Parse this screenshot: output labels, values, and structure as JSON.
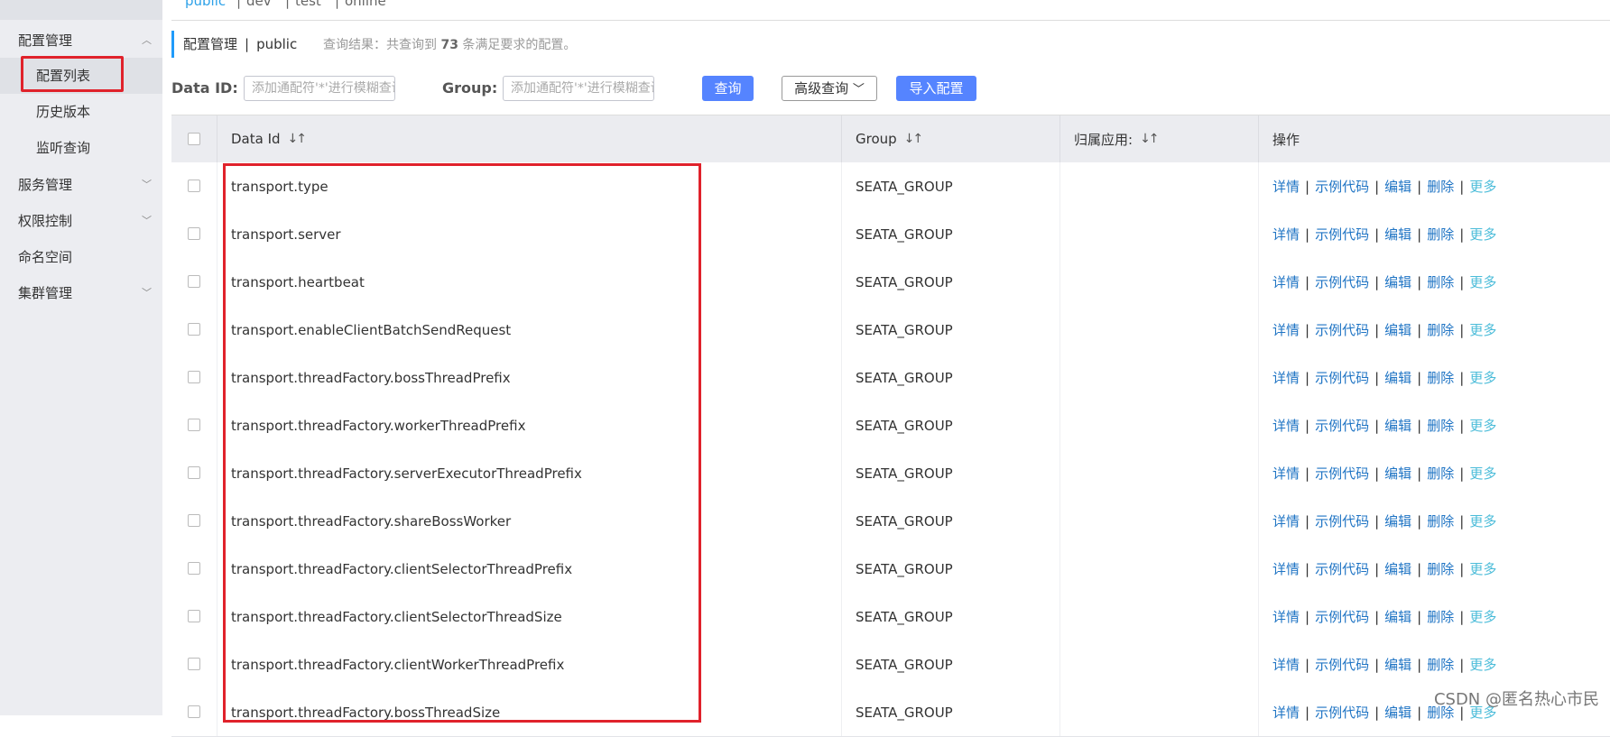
{
  "namespaces": [
    "public",
    "dev",
    "test",
    "online"
  ],
  "sidebar": {
    "items": [
      {
        "label": "配置管理",
        "expanded": true
      },
      {
        "label": "服务管理",
        "expanded": false
      },
      {
        "label": "权限控制",
        "expanded": false
      },
      {
        "label": "命名空间"
      },
      {
        "label": "集群管理",
        "expanded": false
      }
    ],
    "sub_items": [
      "配置列表",
      "历史版本",
      "监听查询"
    ],
    "active_sub": "配置列表"
  },
  "header": {
    "title": "配置管理",
    "namespace": "public",
    "result_prefix": "查询结果：共查询到",
    "result_count": "73",
    "result_suffix": "条满足要求的配置。"
  },
  "filters": {
    "data_id_label": "Data ID:",
    "data_id_placeholder": "添加通配符'*'进行模糊查询",
    "group_label": "Group:",
    "group_placeholder": "添加通配符'*'进行模糊查询",
    "query_button": "查询",
    "advanced_button": "高级查询",
    "import_button": "导入配置"
  },
  "table": {
    "columns": [
      "Data Id",
      "Group",
      "归属应用:",
      "操作"
    ],
    "actions": [
      "详情",
      "示例代码",
      "编辑",
      "删除",
      "更多"
    ],
    "rows": [
      {
        "data_id": "transport.type",
        "group": "SEATA_GROUP",
        "app": ""
      },
      {
        "data_id": "transport.server",
        "group": "SEATA_GROUP",
        "app": ""
      },
      {
        "data_id": "transport.heartbeat",
        "group": "SEATA_GROUP",
        "app": ""
      },
      {
        "data_id": "transport.enableClientBatchSendRequest",
        "group": "SEATA_GROUP",
        "app": ""
      },
      {
        "data_id": "transport.threadFactory.bossThreadPrefix",
        "group": "SEATA_GROUP",
        "app": ""
      },
      {
        "data_id": "transport.threadFactory.workerThreadPrefix",
        "group": "SEATA_GROUP",
        "app": ""
      },
      {
        "data_id": "transport.threadFactory.serverExecutorThreadPrefix",
        "group": "SEATA_GROUP",
        "app": ""
      },
      {
        "data_id": "transport.threadFactory.shareBossWorker",
        "group": "SEATA_GROUP",
        "app": ""
      },
      {
        "data_id": "transport.threadFactory.clientSelectorThreadPrefix",
        "group": "SEATA_GROUP",
        "app": ""
      },
      {
        "data_id": "transport.threadFactory.clientSelectorThreadSize",
        "group": "SEATA_GROUP",
        "app": ""
      },
      {
        "data_id": "transport.threadFactory.clientWorkerThreadPrefix",
        "group": "SEATA_GROUP",
        "app": ""
      },
      {
        "data_id": "transport.threadFactory.bossThreadSize",
        "group": "SEATA_GROUP",
        "app": ""
      }
    ]
  },
  "watermark": "CSDN @匿名热心市民",
  "colors": {
    "primary": "#5584ff",
    "link": "#1f74c4",
    "more_link": "#4bbcd9",
    "highlight": "#e0222b",
    "sidebar_bg": "#ecedf1"
  }
}
